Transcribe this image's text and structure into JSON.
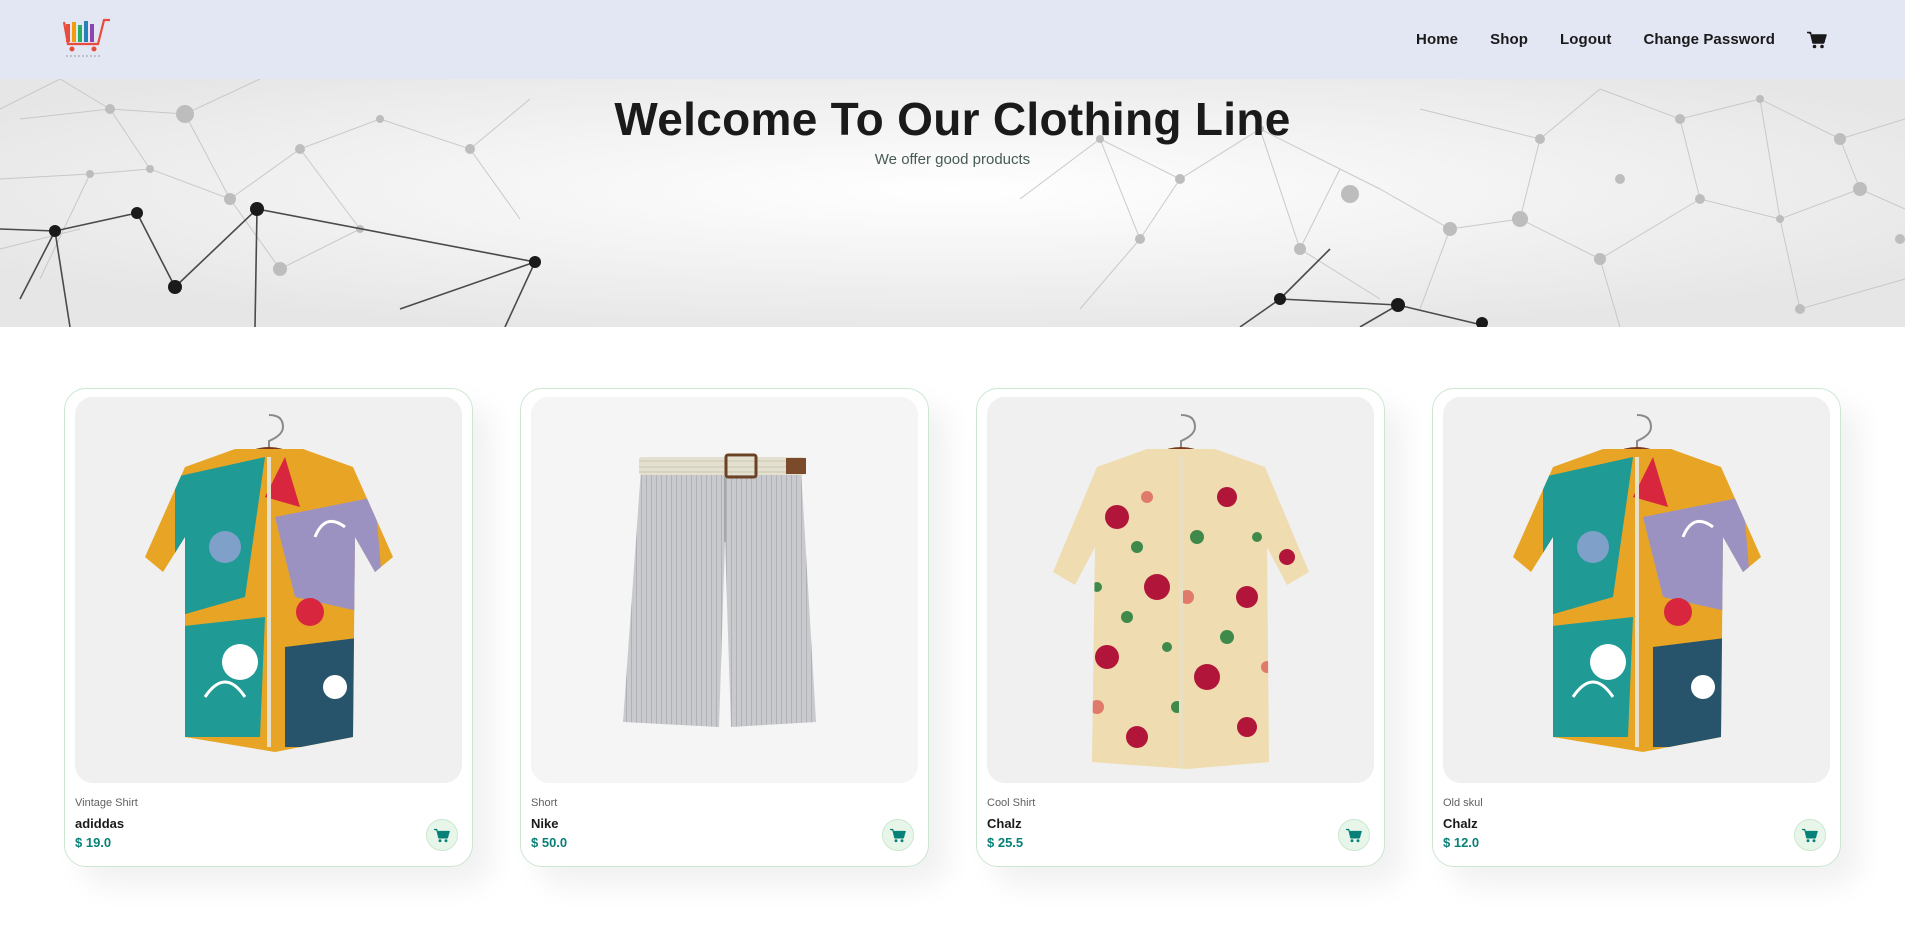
{
  "header": {
    "nav": [
      "Home",
      "Shop",
      "Logout",
      "Change Password"
    ]
  },
  "hero": {
    "title": "Welcome To Our Clothing Line",
    "subtitle": "We offer good products"
  },
  "products": [
    {
      "brand": "Vintage Shirt",
      "name": "adiddas",
      "price": "$ 19.0",
      "image": "abstract-print-shirt"
    },
    {
      "brand": "Short",
      "name": "Nike",
      "price": "$ 50.0",
      "image": "grey-shorts"
    },
    {
      "brand": "Cool Shirt",
      "name": "Chalz",
      "price": "$ 25.5",
      "image": "floral-shirt"
    },
    {
      "brand": "Old skul",
      "name": "Chalz",
      "price": "$ 12.0",
      "image": "abstract-print-shirt"
    }
  ],
  "colors": {
    "header_bg": "#e3e6f3",
    "accent": "#088178",
    "card_border": "#cce7d0",
    "cart_button_bg": "#e8f6ea"
  },
  "icons": {
    "logo": "shopping-cart-logo",
    "nav_cart": "cart-icon",
    "product_cart": "cart-icon"
  }
}
